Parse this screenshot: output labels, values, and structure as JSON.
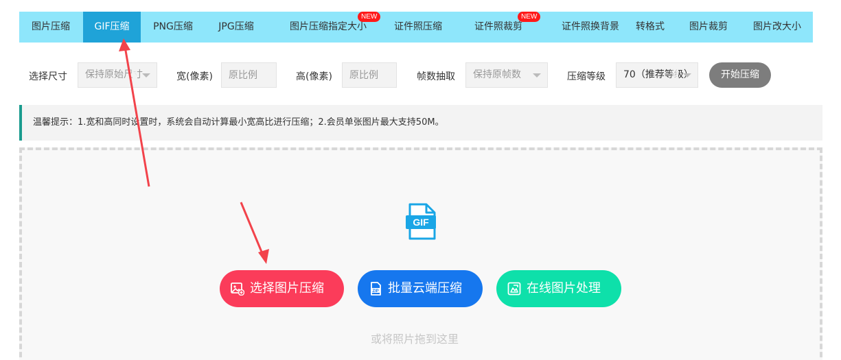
{
  "tabs": [
    {
      "label": "图片压缩"
    },
    {
      "label": "GIF压缩",
      "active": true
    },
    {
      "label": "PNG压缩"
    },
    {
      "label": "JPG压缩"
    },
    {
      "label": "图片压缩指定大小",
      "badge": "NEW"
    },
    {
      "label": "证件照压缩"
    },
    {
      "label": "证件照裁剪",
      "badge": "NEW"
    },
    {
      "label": "证件照换背景"
    },
    {
      "label": "转格式"
    },
    {
      "label": "图片裁剪"
    },
    {
      "label": "图片改大小"
    }
  ],
  "options": {
    "size_label": "选择尺寸",
    "size_value": "保持原始尺寸",
    "width_label": "宽(像素)",
    "width_placeholder": "原比例",
    "height_label": "高(像素)",
    "height_placeholder": "原比例",
    "frames_label": "帧数抽取",
    "frames_value": "保持原帧数",
    "level_label": "压缩等级",
    "level_value": "70（推荐等级）",
    "start_button": "开始压缩"
  },
  "notice": "温馨提示：1.宽和高同时设置时，系统会自动计算最小宽高比进行压缩；2.会员单张图片最大支持50M。",
  "upload": {
    "file_icon_text": "GIF",
    "select_button": "选择图片压缩",
    "batch_button": "批量云端压缩",
    "online_button": "在线图片处理",
    "drag_hint": "或将照片拖到这里"
  },
  "colors": {
    "tabbar": "#8ee6fb",
    "tab_active": "#1fa3d8",
    "badge": "#ff1a1a",
    "btn_select": "#fb3c5a",
    "btn_batch": "#1677ee",
    "btn_online": "#0ee0aa",
    "annotation_arrow": "#f2434b"
  }
}
